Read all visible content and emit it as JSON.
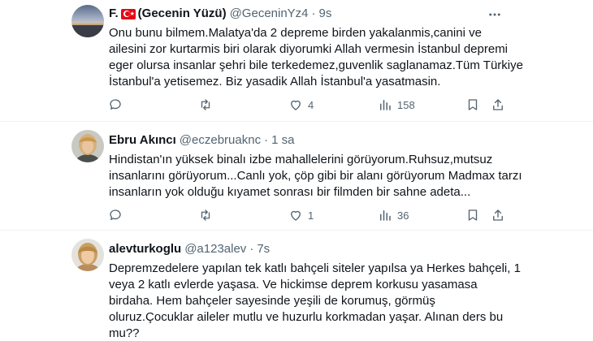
{
  "tweets": [
    {
      "name_pre": "F.",
      "name_post": "(Gecenin Yüzü)",
      "handle": "@GeceninYz4",
      "dot": "·",
      "time": "9s",
      "lines": [
        "Onu bunu bilmem.Malatya'da 2  depreme birden yakalanmis,canini ve",
        "ailesini zor kurtarmis biri olarak diyorumki Allah vermesin İstanbul depremi",
        "eger olursa insanlar şehri bile terkedemez,guvenlik saglanamaz.Tüm Türkiye",
        "İstanbul'a yetisemez. Biz yasadik Allah İstanbul'a yasatmasin."
      ],
      "likes": "4",
      "views": "158",
      "avatar_icon": "sunset-landscape-avatar",
      "flag_icon": "turkish-flag-icon"
    },
    {
      "name": "Ebru Akıncı",
      "handle": "@eczebruaknc",
      "dot": "·",
      "time": "1 sa",
      "lines": [
        "Hindistan'ın yüksek binalı izbe mahallelerini görüyorum.Ruhsuz,mutsuz",
        "insanlarını görüyorum...Canlı yok, çöp gibi bir alanı görüyorum Madmax tarzı",
        "insanların yok olduğu kıyamet sonrası bir filmden bir sahne adeta..."
      ],
      "likes": "1",
      "views": "36",
      "avatar_icon": "woman-portrait-avatar"
    },
    {
      "name": "alevturkoglu",
      "handle": "@a123alev",
      "dot": "·",
      "time": "7s",
      "lines": [
        "Depremzedelere yapılan tek katlı bahçeli siteler yapılsa ya Herkes bahçeli, 1",
        "veya 2 katlı evlerde yaşasa. Ve hickimse deprem korkusu yasamasa",
        "birdaha. Hem bahçeler sayesinde yeşili de korumuş, görmüş",
        "oluruz.Çocuklar aileler mutlu ve huzurlu korkmadan yaşar.  Alınan ders bu",
        "mu??"
      ],
      "avatar_icon": "woman-portrait-avatar"
    }
  ],
  "colors": {
    "text": "#0f1419",
    "secondary": "#536471",
    "divider": "#eff3f4",
    "flag_red": "#e30a17"
  }
}
